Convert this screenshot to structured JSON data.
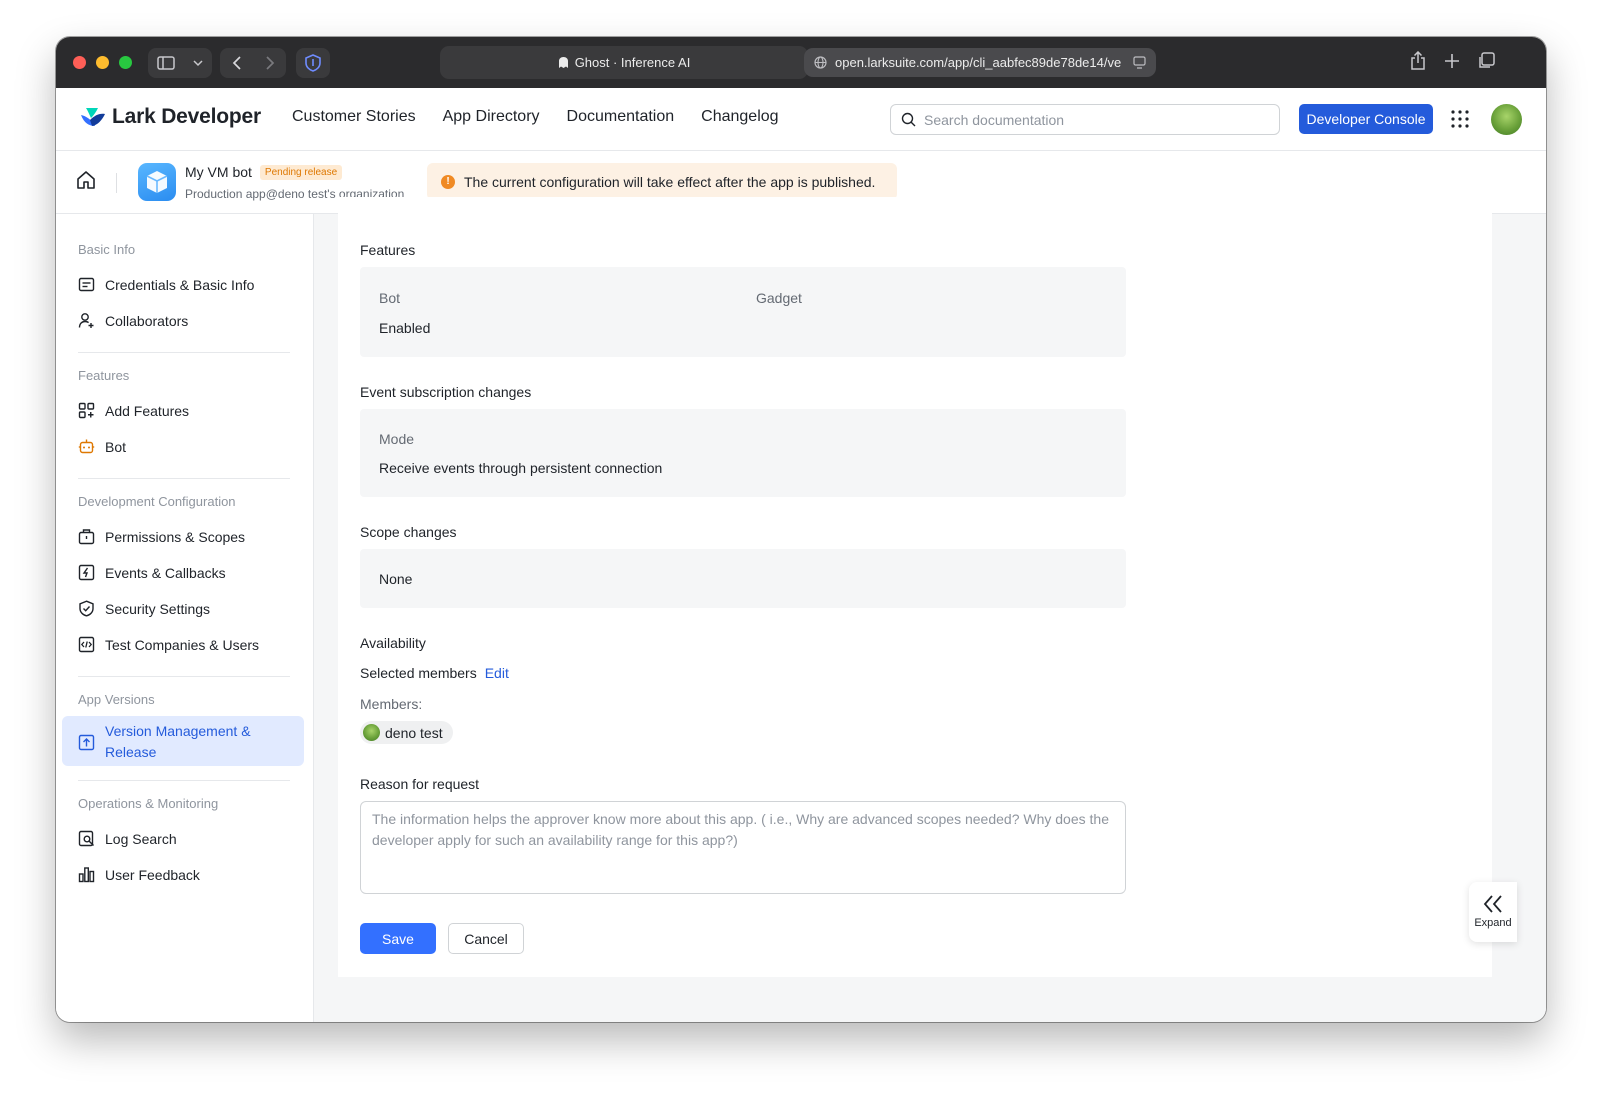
{
  "browser": {
    "tab_title": "Ghost · Inference AI",
    "url": "open.larksuite.com/app/cli_aabfec89de78de14/ve"
  },
  "topnav": {
    "logo": "Lark Developer",
    "links": [
      "Customer Stories",
      "App Directory",
      "Documentation",
      "Changelog"
    ],
    "search_placeholder": "Search documentation",
    "console_button": "Developer Console"
  },
  "app": {
    "name": "My VM bot",
    "status_badge": "Pending release",
    "subtitle": "Production app@deno test's organization",
    "notice": "The current configuration will take effect after the app is published."
  },
  "sidebar": {
    "sections": [
      {
        "title": "Basic Info",
        "items": [
          "Credentials & Basic Info",
          "Collaborators"
        ]
      },
      {
        "title": "Features",
        "items": [
          "Add Features",
          "Bot"
        ]
      },
      {
        "title": "Development Configuration",
        "items": [
          "Permissions & Scopes",
          "Events & Callbacks",
          "Security Settings",
          "Test Companies & Users"
        ]
      },
      {
        "title": "App Versions",
        "items": [
          "Version Management & Release"
        ]
      },
      {
        "title": "Operations & Monitoring",
        "items": [
          "Log Search",
          "User Feedback"
        ]
      }
    ]
  },
  "content": {
    "features": {
      "title": "Features",
      "col1_label": "Bot",
      "col1_value": "Enabled",
      "col2_label": "Gadget"
    },
    "events": {
      "title": "Event subscription changes",
      "label": "Mode",
      "value": "Receive events through persistent connection"
    },
    "scopes": {
      "title": "Scope changes",
      "value": "None"
    },
    "availability": {
      "title": "Availability",
      "selected": "Selected members",
      "edit": "Edit",
      "members_label": "Members:",
      "member": "deno test"
    },
    "reason": {
      "title": "Reason for request",
      "placeholder": "The information helps the approver know more about this app. ( i.e., Why are advanced scopes needed? Why does the developer apply for such an availability range for this app?)"
    },
    "save": "Save",
    "cancel": "Cancel",
    "expand": "Expand"
  }
}
